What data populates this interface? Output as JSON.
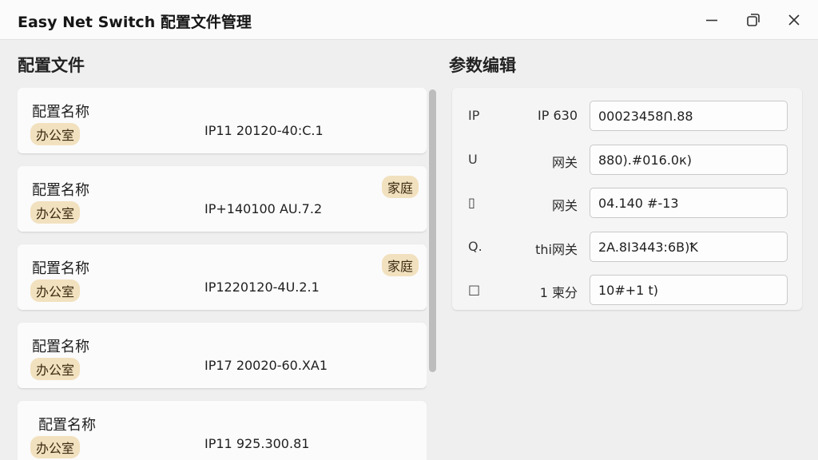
{
  "window": {
    "title": "Easy Net Switch 配置文件管理",
    "minimize_icon": "minimize-icon",
    "restore_icon": "restore-icon",
    "close_icon": "close-icon"
  },
  "profiles": {
    "heading": "配置文件",
    "items": [
      {
        "name": "配置名称",
        "tag": "办公室",
        "badge": "",
        "ip": "IP11 20120-40:C.1"
      },
      {
        "name": "配置名称",
        "tag": "办公室",
        "badge": "家庭",
        "ip": "IP+140100 AU.7.2"
      },
      {
        "name": "配置名称",
        "tag": "办公室",
        "badge": "家庭",
        "ip": "IP1220120-4U.2.1"
      },
      {
        "name": "配置名称",
        "tag": "办公室",
        "badge": "",
        "ip": "IP17 20020-60.XA1"
      },
      {
        "name": "配置名称",
        "tag": "办公室",
        "badge": "",
        "ip": "IP11 925.300.81"
      }
    ]
  },
  "editor": {
    "heading": "参数编辑",
    "fields": [
      {
        "icon": "IP",
        "label": "IP 630",
        "value": "00023458Ո.88"
      },
      {
        "icon": "U",
        "label": "网关",
        "value": "880).#016.0к)"
      },
      {
        "icon": "▯",
        "label": "网关",
        "value": "04.140 #-13"
      },
      {
        "icon": "Q.",
        "label": "thi网关",
        "value": "2A.8I3443:6B)Ꝁ"
      },
      {
        "icon": "□",
        "label": "1 柬分",
        "value": "10#+1 t)"
      }
    ]
  }
}
